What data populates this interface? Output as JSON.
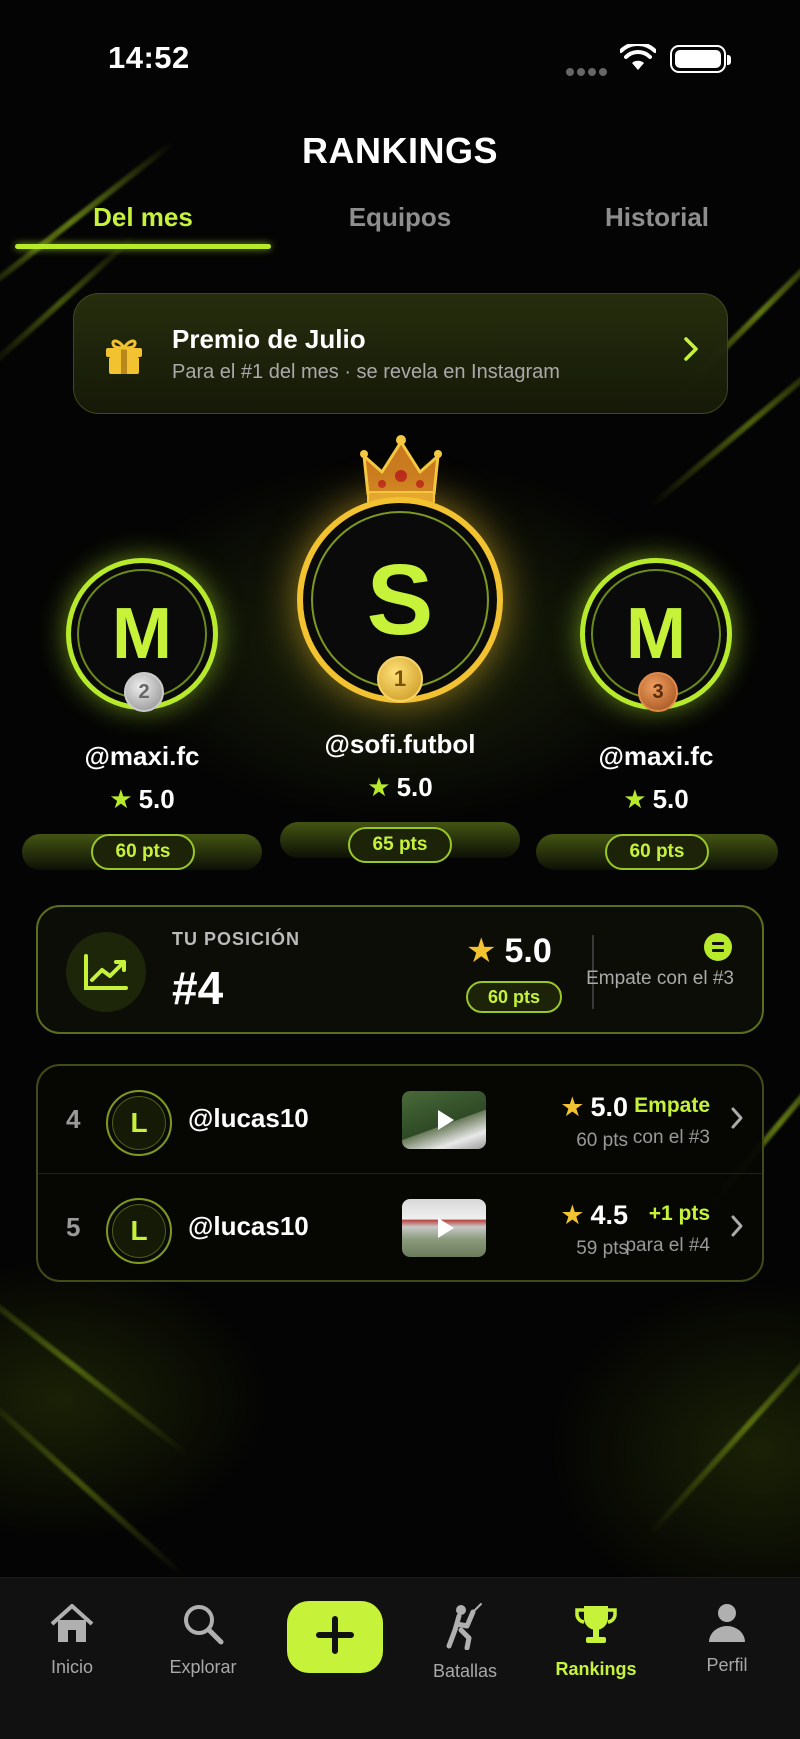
{
  "status_bar": {
    "time": "14:52"
  },
  "header": {
    "title": "RANKINGS"
  },
  "tabs": [
    {
      "label": "Del mes",
      "active": true
    },
    {
      "label": "Equipos",
      "active": false
    },
    {
      "label": "Historial",
      "active": false
    }
  ],
  "prize": {
    "icon": "gift-icon",
    "title": "Premio de Julio",
    "subtitle": "Para el #1 del mes · se revela en Instagram"
  },
  "podium": {
    "first": {
      "initial": "S",
      "handle": "@sofi.futbol",
      "rating": "5.0",
      "points": "65 pts",
      "medal": "1",
      "crown": "crown-icon"
    },
    "second": {
      "initial": "M",
      "handle": "@maxi.fc",
      "rating": "5.0",
      "points": "60 pts",
      "medal": "2"
    },
    "third": {
      "initial": "M",
      "handle": "@maxi.fc",
      "rating": "5.0",
      "points": "60 pts",
      "medal": "3"
    }
  },
  "my_position": {
    "label": "TU POSICIÓN",
    "rank": "#4",
    "rating": "5.0",
    "points": "60 pts",
    "status_text": "Empate con el #3",
    "icon": "trend-up-icon"
  },
  "leaderboard": [
    {
      "position": "4",
      "initial": "L",
      "handle": "@lucas10",
      "rating": "5.0",
      "points": "60 pts",
      "status_top": "Empate",
      "status_bottom": "con el #3"
    },
    {
      "position": "5",
      "initial": "L",
      "handle": "@lucas10",
      "rating": "4.5",
      "points": "59 pts",
      "status_top": "+1 pts",
      "status_bottom": "para el #4"
    }
  ],
  "nav": {
    "items": [
      {
        "label": "Inicio",
        "icon": "home-icon"
      },
      {
        "label": "Explorar",
        "icon": "search-icon"
      },
      {
        "label": "",
        "icon": "plus-icon"
      },
      {
        "label": "Batallas",
        "icon": "fencer-icon"
      },
      {
        "label": "Rankings",
        "icon": "trophy-icon",
        "active": true
      },
      {
        "label": "Perfil",
        "icon": "user-icon"
      }
    ]
  },
  "colors": {
    "accent": "#c6f23a",
    "gold": "#f2c230",
    "silver": "#b8b8b8",
    "bronze": "#c8642a",
    "background": "#040404"
  }
}
